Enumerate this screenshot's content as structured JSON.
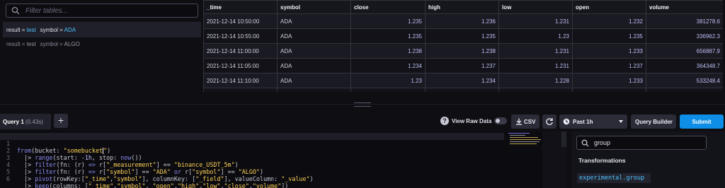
{
  "tables_panel": {
    "filter_placeholder": "Filter tables...",
    "items": [
      {
        "k1": "result",
        "v1": "test",
        "k2": "symbol",
        "v2": "ADA",
        "active": true
      },
      {
        "k1": "result",
        "v1": "test",
        "k2": "symbol",
        "v2": "ALGO",
        "active": false
      }
    ]
  },
  "grid": {
    "columns": [
      "_time",
      "symbol",
      "close",
      "high",
      "low",
      "open",
      "volume"
    ],
    "rows": [
      [
        "2021-12-14 10:50:00",
        "ADA",
        "1.235",
        "1.236",
        "1.231",
        "1.232",
        "381278.6"
      ],
      [
        "2021-12-14 10:55:00",
        "ADA",
        "1.235",
        "1.235",
        "1.23",
        "1.235",
        "336962.3"
      ],
      [
        "2021-12-14 11:00:00",
        "ADA",
        "1.238",
        "1.238",
        "1.231",
        "1.233",
        "656887.9"
      ],
      [
        "2021-12-14 11:05:00",
        "ADA",
        "1.234",
        "1.237",
        "1.231",
        "1.237",
        "364348.7"
      ],
      [
        "2021-12-14 11:10:00",
        "ADA",
        "1.23",
        "1.234",
        "1.228",
        "1.233",
        "533248.4"
      ],
      [
        "2021-12-14 11:15:00",
        "ADA",
        "1.227",
        "1.231",
        "1.227",
        "1.229",
        "378376.39999999997"
      ],
      [
        "",
        "",
        "",
        "",
        "",
        "",
        ""
      ]
    ]
  },
  "toolbar": {
    "query_tab_label": "Query 1",
    "query_tab_time": "(0.43s)",
    "add_tab": "+",
    "help": "?",
    "view_raw_label": "View Raw Data",
    "view_raw_on": false,
    "csv_label": "CSV",
    "time_range": "Past 1h",
    "query_builder_label": "Query Builder",
    "submit_label": "Submit"
  },
  "editor": {
    "lines": [
      {
        "n": "1",
        "current": true
      },
      {
        "n": "2"
      },
      {
        "n": "3"
      },
      {
        "n": "4"
      },
      {
        "n": "5"
      },
      {
        "n": "6"
      }
    ],
    "tokens": {
      "l1_fn": "from",
      "l1_a": "(bucket: ",
      "l1_str": "\"somebucket",
      "l1_str_end": "\"",
      "l1_end": ")",
      "l2_pipe": "  |> ",
      "l2_fn": "range",
      "l2_a": "(start: ",
      "l2_num": "-1h",
      "l2_b": ", stop: ",
      "l2_fn2": "now",
      "l2_c": "())",
      "l3_pipe": "  |> ",
      "l3_fn": "filter",
      "l3_a": "(fn: (r) ",
      "l3_arrow": "=>",
      "l3_b": " r[",
      "l3_s1": "\"_measurement\"",
      "l3_c": "] == ",
      "l3_s2": "\"binance_USDT_5m\"",
      "l3_d": ")",
      "l4_pipe": "  |> ",
      "l4_fn": "filter",
      "l4_a": "(fn: (r) ",
      "l4_arrow": "=>",
      "l4_b": " r[",
      "l4_s1": "\"symbol\"",
      "l4_c": "] == ",
      "l4_s2": "\"ADA\"",
      "l4_or": " or ",
      "l4_d": "r[",
      "l4_s3": "\"symbol\"",
      "l4_e": "] == ",
      "l4_s4": "\"ALGO\"",
      "l4_f": ")",
      "l5_pipe": "  |> ",
      "l5_fn": "pivot",
      "l5_a": "(rowKey:[",
      "l5_s1": "\"_time\"",
      "l5_b": ",",
      "l5_s2": "\"symbol\"",
      "l5_c": "], columnKey: [",
      "l5_s3": "\"_field\"",
      "l5_d": "], valueColumn: ",
      "l5_s4": "\"_value\"",
      "l5_e": ")",
      "l6_pipe": "  |> ",
      "l6_fn": "keep",
      "l6_a": "(columns: [",
      "l6_s1": "\"_time\"",
      "l6_b": ",",
      "l6_s2": "\"symbol\"",
      "l6_c": ", ",
      "l6_s3": "\"open\"",
      "l6_d": ",",
      "l6_s4": "\"high\"",
      "l6_e": ",",
      "l6_s5": "\"low\"",
      "l6_f": ",",
      "l6_s6": "\"close\"",
      "l6_g": ",",
      "l6_s7": "\"volume\"",
      "l6_h": "])"
    }
  },
  "functions_panel": {
    "search_value": "group",
    "heading": "Transformations",
    "items": [
      "experimental.group"
    ]
  },
  "colors": {
    "accent": "#0e8ee6",
    "highlight": "#4cc3ff",
    "string": "#ffd255",
    "keyword": "#8c8cf0",
    "background": "#0e0e13"
  }
}
